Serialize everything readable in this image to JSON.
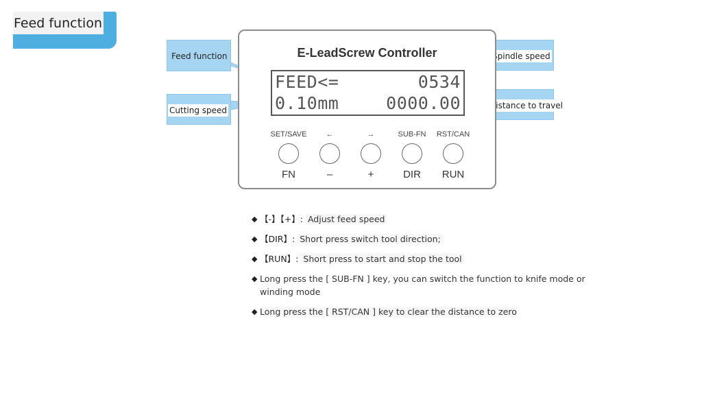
{
  "title": "Feed function",
  "panel": {
    "title": "E-LeadScrew Controller",
    "lcd": {
      "row1_left": "FEED<=",
      "row1_right": "0534",
      "row2_left": "0.10mm",
      "row2_right": "0000.00"
    },
    "keys": [
      {
        "top": "SET/SAVE",
        "bottom": "FN"
      },
      {
        "top": "←",
        "bottom": "–"
      },
      {
        "top": "→",
        "bottom": "+"
      },
      {
        "top": "SUB-FN",
        "bottom": "DIR"
      },
      {
        "top": "RST/CAN",
        "bottom": "RUN"
      }
    ]
  },
  "callouts": {
    "feed_function": "Feed function",
    "cutting_speed": "Cutting speed",
    "spindle_speed": "Spindle speed",
    "distance_to_travel": "Distance to travel"
  },
  "bullets": [
    {
      "marker": "◆",
      "key": "【-】【+】:",
      "desc": "Adjust feed speed"
    },
    {
      "marker": "◆",
      "key": "【DIR】:",
      "desc": "Short press switch tool direction;"
    },
    {
      "marker": "◆",
      "key": "【RUN】:",
      "desc": "Short press to start and stop the tool"
    },
    {
      "marker": "◆",
      "key": "",
      "desc": "Long press the [ SUB-FN ] key, you can switch the function to knife mode or winding mode"
    },
    {
      "marker": "◆",
      "key": "",
      "desc": "Long press the [ RST/CAN ] key to clear the distance to zero"
    }
  ]
}
